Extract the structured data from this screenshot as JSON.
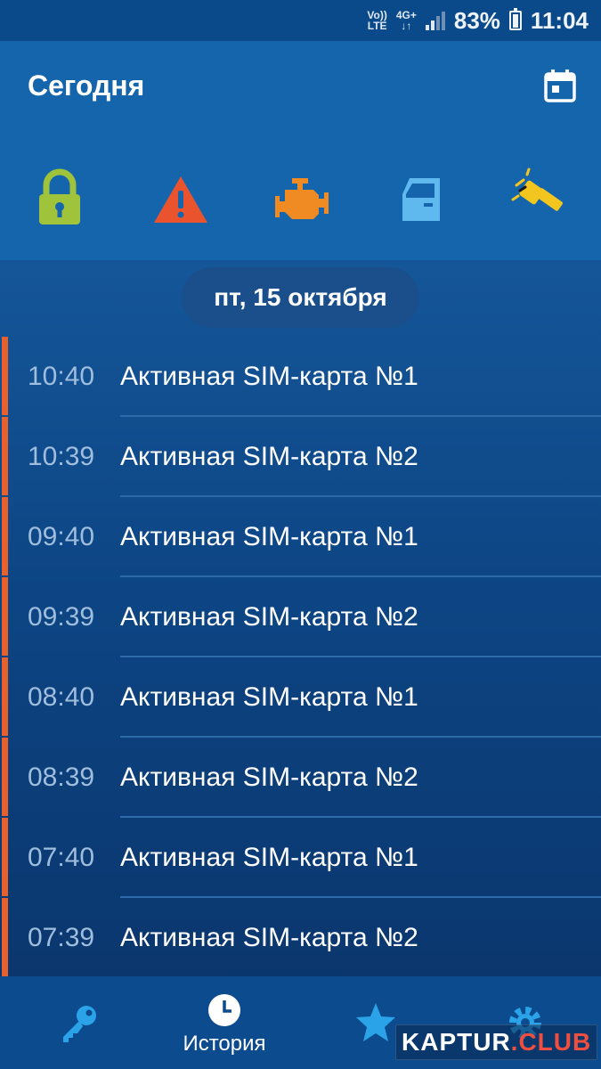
{
  "status_bar": {
    "volte_top": "Vo))",
    "volte_bottom": "LTE",
    "network_top": "4G+",
    "network_bottom": "↓↑",
    "battery": "83%",
    "time": "11:04"
  },
  "header": {
    "title": "Сегодня"
  },
  "status_icons": [
    {
      "name": "lock-icon",
      "color": "#9fc33a"
    },
    {
      "name": "alarm-warning-icon",
      "color": "#e9532d"
    },
    {
      "name": "engine-icon",
      "color": "#f08a22"
    },
    {
      "name": "car-door-icon",
      "color": "#5fb8ee"
    },
    {
      "name": "shock-sensor-icon",
      "color": "#f3c51f"
    }
  ],
  "date": "пт, 15 октября",
  "events": [
    {
      "time": "10:40",
      "text": "Активная SIM-карта №1"
    },
    {
      "time": "10:39",
      "text": "Активная SIM-карта №2"
    },
    {
      "time": "09:40",
      "text": "Активная SIM-карта №1"
    },
    {
      "time": "09:39",
      "text": "Активная SIM-карта №2"
    },
    {
      "time": "08:40",
      "text": "Активная SIM-карта №1"
    },
    {
      "time": "08:39",
      "text": "Активная SIM-карта №2"
    },
    {
      "time": "07:40",
      "text": "Активная SIM-карта №1"
    },
    {
      "time": "07:39",
      "text": "Активная SIM-карта №2"
    }
  ],
  "bottom_nav": {
    "history_label": "История"
  },
  "watermark": {
    "part1": "KAPTUR",
    "part2": ".CLUB"
  },
  "colors": {
    "accent": "#e8612c",
    "header_bg": "#1565ad",
    "nav_icon": "#2aa3e8"
  }
}
